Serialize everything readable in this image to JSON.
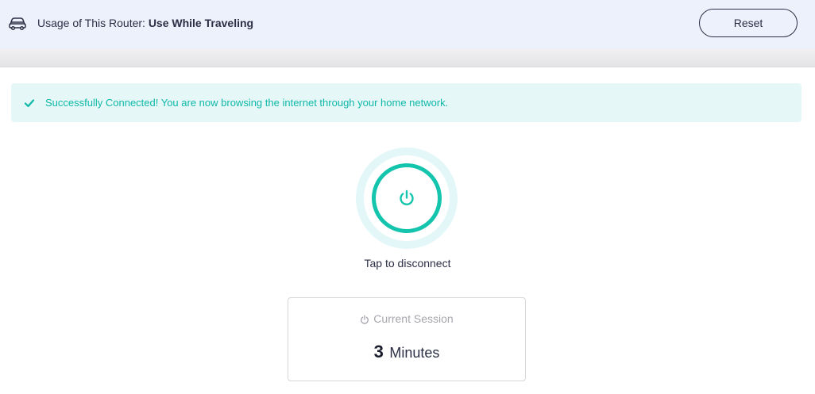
{
  "header": {
    "usage_label": "Usage of This Router:",
    "usage_value": "Use While Traveling",
    "reset_label": "Reset",
    "icon": "car-icon"
  },
  "alert": {
    "icon": "check-icon",
    "message": "Successfully Connected! You are now browsing the internet through your home network.",
    "color": "#0fb8a8"
  },
  "power": {
    "icon": "power-icon",
    "label": "Tap to disconnect",
    "accent": "#15c4ad"
  },
  "session": {
    "icon": "timer-icon",
    "title": "Current Session",
    "value": "3",
    "unit": "Minutes"
  }
}
